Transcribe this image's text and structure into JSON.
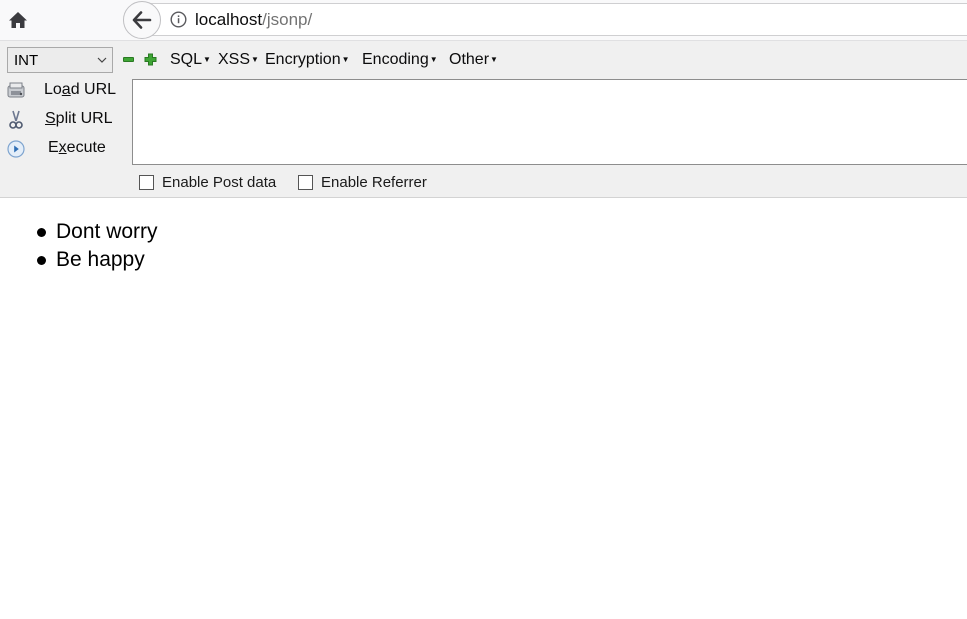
{
  "address_bar": {
    "host": "localhost",
    "path": "/jsonp/"
  },
  "hackbar": {
    "type_select": {
      "value": "INT"
    },
    "menus": [
      {
        "label": "SQL"
      },
      {
        "label": "XSS"
      },
      {
        "label": "Encryption"
      },
      {
        "label": "Encoding"
      },
      {
        "label": "Other"
      }
    ],
    "actions": {
      "load_url": {
        "prefix": "Lo",
        "underline": "a",
        "suffix": "d URL"
      },
      "split_url": {
        "prefix": "",
        "underline": "S",
        "suffix": "plit URL"
      },
      "execute": {
        "prefix": "E",
        "underline": "x",
        "suffix": "ecute"
      }
    },
    "url_input": {
      "value": ""
    },
    "checkboxes": {
      "post_data": {
        "label": "Enable Post data",
        "checked": false
      },
      "referrer": {
        "label": "Enable Referrer",
        "checked": false
      }
    }
  },
  "page": {
    "items": [
      "Dont worry",
      "Be happy"
    ]
  },
  "colors": {
    "toolbar_bg": "#f9f9fa",
    "hackbar_bg": "#f0f0f0",
    "accent_green": "#3fa535"
  }
}
